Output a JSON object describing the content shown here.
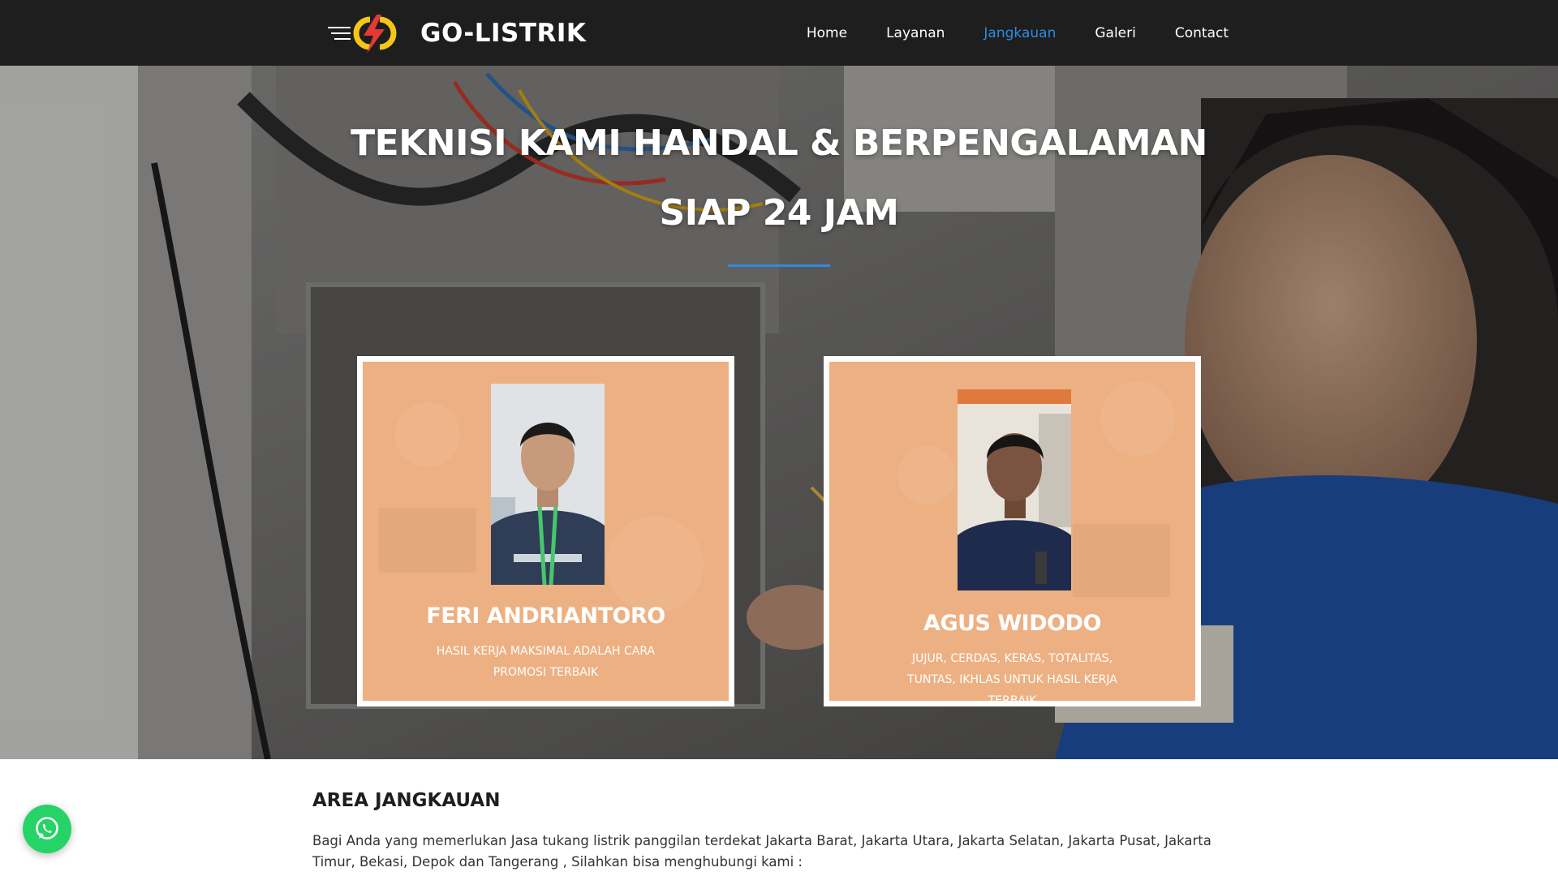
{
  "brand": {
    "name": "GO-LISTRIK",
    "logo_icon": "lightning-bolt-logo"
  },
  "nav": {
    "items": [
      {
        "label": "Home",
        "active": false
      },
      {
        "label": "Layanan",
        "active": false
      },
      {
        "label": "Jangkauan",
        "active": true
      },
      {
        "label": "Galeri",
        "active": false
      },
      {
        "label": "Contact",
        "active": false
      }
    ]
  },
  "hero": {
    "title_line1": "TEKNISI KAMI HANDAL & BERPENGALAMAN",
    "title_line2": "SIAP 24 JAM",
    "accent_color": "#2f8ae6"
  },
  "team": [
    {
      "name": "FERI ANDRIANTORO",
      "description": "HASIL KERJA MAKSIMAL ADALAH CARA PROMOSI TERBAIK"
    },
    {
      "name": "AGUS WIDODO",
      "description": "JUJUR, CERDAS, KERAS, TOTALITAS, TUNTAS, IKHLAS UNTUK HASIL KERJA TERBAIK"
    }
  ],
  "area": {
    "title": "AREA JANGKAUAN",
    "text": "Bagi Anda yang memerlukan Jasa tukang listrik panggilan terdekat Jakarta Barat, Jakarta Utara, Jakarta Selatan, Jakarta Pusat, Jakarta Timur, Bekasi, Depok dan Tangerang , Silahkan bisa menghubungi kami :"
  },
  "whatsapp": {
    "icon": "whatsapp-icon",
    "color": "#25d366"
  },
  "colors": {
    "navbar": "#1e1e1e",
    "card": "#edb083",
    "active_nav": "#2f8ae6"
  }
}
